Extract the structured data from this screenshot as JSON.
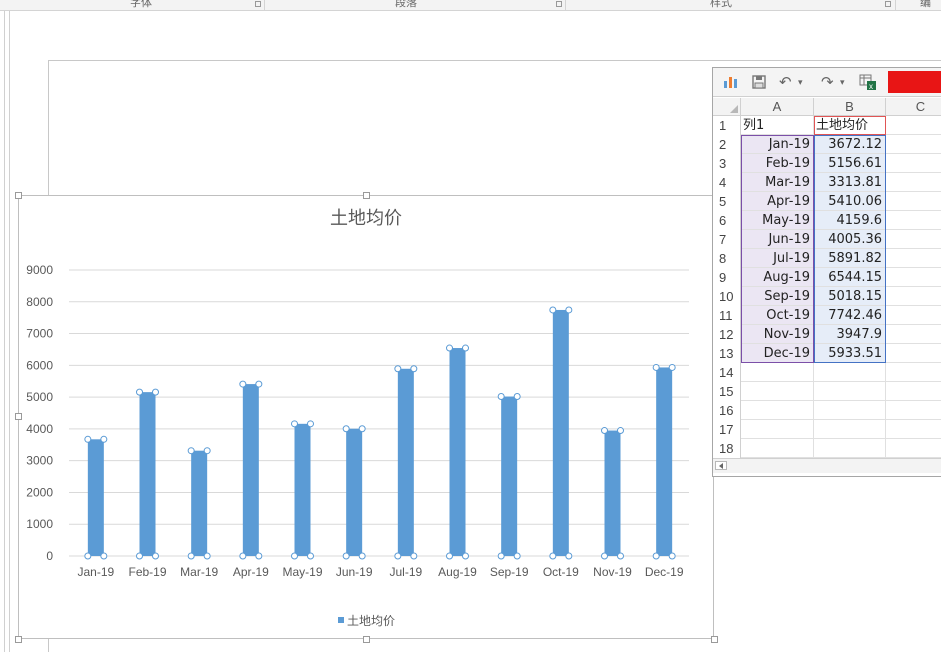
{
  "ribbon": {
    "groups": [
      "字体",
      "段落",
      "样式",
      "编辑"
    ]
  },
  "toolbar": {
    "icons": [
      "chart-icon",
      "save-icon",
      "undo-icon",
      "redo-icon",
      "excel-icon"
    ]
  },
  "sheet": {
    "columns": [
      "A",
      "B",
      "C"
    ],
    "row_numbers": [
      "1",
      "2",
      "3",
      "4",
      "5",
      "6",
      "7",
      "8",
      "9",
      "10",
      "11",
      "12",
      "13",
      "14",
      "15",
      "16",
      "17",
      "18"
    ],
    "header": {
      "A": "列1",
      "B": "土地均价"
    },
    "rows": [
      {
        "A": "Jan-19",
        "B": "3672.12"
      },
      {
        "A": "Feb-19",
        "B": "5156.61"
      },
      {
        "A": "Mar-19",
        "B": "3313.81"
      },
      {
        "A": "Apr-19",
        "B": "5410.06"
      },
      {
        "A": "May-19",
        "B": "4159.6"
      },
      {
        "A": "Jun-19",
        "B": "4005.36"
      },
      {
        "A": "Jul-19",
        "B": "5891.82"
      },
      {
        "A": "Aug-19",
        "B": "6544.15"
      },
      {
        "A": "Sep-19",
        "B": "5018.15"
      },
      {
        "A": "Oct-19",
        "B": "7742.46"
      },
      {
        "A": "Nov-19",
        "B": "3947.9"
      },
      {
        "A": "Dec-19",
        "B": "5933.51"
      }
    ]
  },
  "colors": {
    "bar": "#5b9bd5",
    "grid": "#d9d9d9",
    "text": "#595959",
    "accent_red": "#e81515"
  },
  "chart_data": {
    "type": "bar",
    "title": "土地均价",
    "categories": [
      "Jan-19",
      "Feb-19",
      "Mar-19",
      "Apr-19",
      "May-19",
      "Jun-19",
      "Jul-19",
      "Aug-19",
      "Sep-19",
      "Oct-19",
      "Nov-19",
      "Dec-19"
    ],
    "series": [
      {
        "name": "土地均价",
        "values": [
          3672.12,
          5156.61,
          3313.81,
          5410.06,
          4159.6,
          4005.36,
          5891.82,
          6544.15,
          5018.15,
          7742.46,
          3947.9,
          5933.51
        ]
      }
    ],
    "yticks": [
      "0",
      "1000",
      "2000",
      "3000",
      "4000",
      "5000",
      "6000",
      "7000",
      "8000",
      "9000"
    ],
    "ylim": [
      0,
      9000
    ],
    "grid": true,
    "legend": "bottom"
  }
}
